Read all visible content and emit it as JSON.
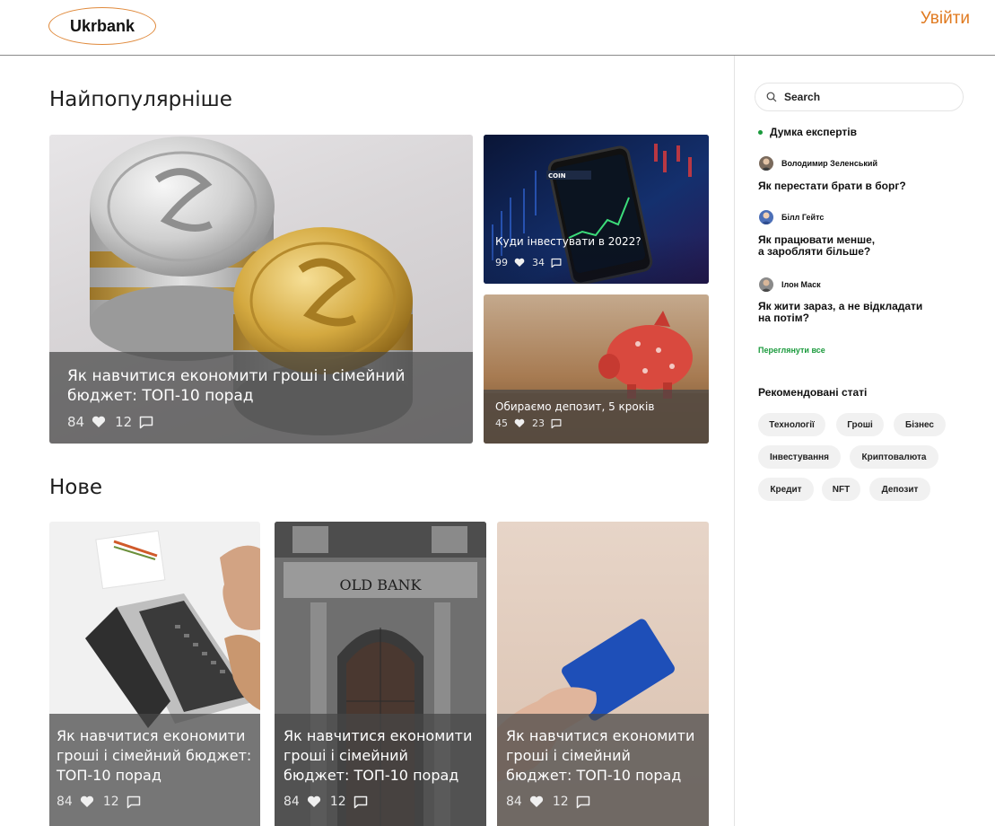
{
  "header": {
    "logo": "Ukrbank",
    "login": "Увійти"
  },
  "popular": {
    "title": "Найпопулярніше",
    "featured": {
      "title": "Як навчитися економити гроші і сімейний бюджет: ТОП-10 порад",
      "likes": "84",
      "comments": "12"
    },
    "side_cards": [
      {
        "title": "Куди інвестувати в 2022?",
        "likes": "99",
        "comments": "34"
      },
      {
        "title": "Обираємо депозит, 5 кроків",
        "likes": "45",
        "comments": "23"
      }
    ]
  },
  "new": {
    "title": "Нове",
    "cards": [
      {
        "title": "Як навчитися економити гроші і сімейний бюджет: ТОП-10 порад",
        "likes": "84",
        "comments": "12",
        "image_text": ""
      },
      {
        "title": "Як навчитися економити гроші і сімейний бюджет: ТОП-10 порад",
        "likes": "84",
        "comments": "12",
        "image_text": "OLD BANK"
      },
      {
        "title": "Як навчитися економити гроші і сімейний бюджет: ТОП-10 порад",
        "likes": "84",
        "comments": "12",
        "image_text": ""
      }
    ]
  },
  "sidebar": {
    "search_placeholder": "Search",
    "experts_heading": "Думка експертів",
    "experts": [
      {
        "author": "Володимир Зеленський",
        "title_lines": [
          "Як перестати брати в борг?"
        ]
      },
      {
        "author": "Білл Гейтс",
        "title_lines": [
          "Як працювати менше,",
          "а заробляти більше?"
        ]
      },
      {
        "author": "Ілон Маск",
        "title_lines": [
          "Як жити зараз, а не відкладати",
          "на потім?"
        ]
      }
    ],
    "view_all": "Переглянути все",
    "recommended_heading": "Рекомендовані статі",
    "tags": [
      "Технології",
      "Гроші",
      "Бізнес",
      "Інвестування",
      "Криптовалюта",
      "Кредит",
      "NFT",
      "Депозит"
    ]
  },
  "colors": {
    "accent": "#e07a20",
    "green": "#1a9a3c",
    "overlay": "#464646"
  },
  "icons": {
    "like": "heart-icon",
    "comment": "comment-icon",
    "search": "search-icon"
  }
}
